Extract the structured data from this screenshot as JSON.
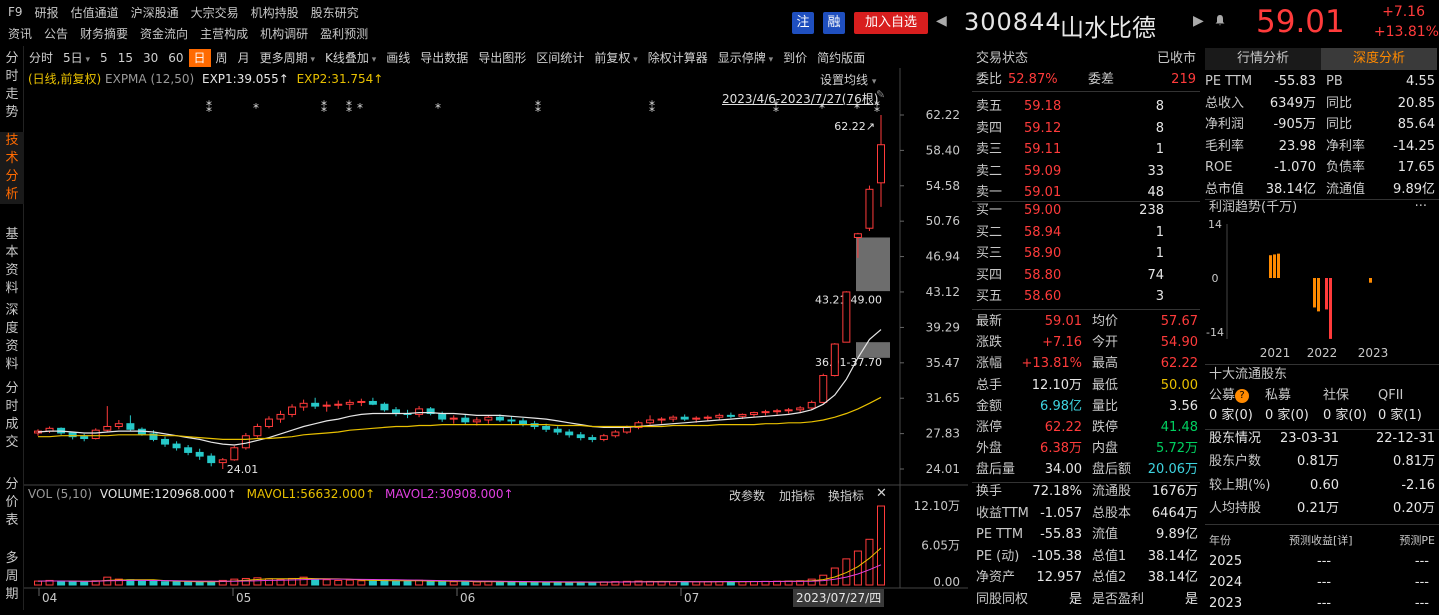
{
  "nav": {
    "row1": [
      "F9",
      "研报",
      "估值通道",
      "沪深股通",
      "大宗交易",
      "机构持股",
      "股东研究"
    ],
    "row2": [
      "资讯",
      "公告",
      "财务摘要",
      "资金流向",
      "主营构成",
      "机构调研",
      "盈利预测"
    ]
  },
  "title": {
    "zhu": "注",
    "rong": "融",
    "add_watch": "加入自选",
    "code": "300844",
    "name": "山水比德",
    "price": "59.01",
    "change": "+7.16",
    "change_pct": "+13.81%"
  },
  "toolbar": [
    "分时",
    "5日",
    "5",
    "15",
    "30",
    "60",
    "日",
    "周",
    "月",
    "更多周期",
    "K线叠加",
    "画线",
    "导出数据",
    "导出图形",
    "区间统计",
    "前复权",
    "除权计算器",
    "显示停牌",
    "到价",
    "简约版面"
  ],
  "toolbar_dropdowns": [
    "5日",
    "更多周期",
    "K线叠加",
    "前复权",
    "显示停牌"
  ],
  "toolbar_active": "日",
  "sidebar": [
    "分时走势",
    "技术分析",
    "基本资料",
    "深度资料",
    "分时成交",
    "分价表",
    "多周期"
  ],
  "sidebar_active": "技术分析",
  "chart": {
    "legend_main": {
      "prefix": "(日线,前复权)",
      "name": "EXPMA",
      "params": "(12,50)",
      "exp1": "EXP1:39.055↑",
      "exp2": "EXP2:31.754↑"
    },
    "set_ma": "设置均线",
    "range_label": "2023/4/6-2023/7/27(76根)",
    "y_ticks": [
      "62.22",
      "58.40",
      "54.58",
      "50.76",
      "46.94",
      "43.12",
      "39.29",
      "35.47",
      "31.65",
      "27.83",
      "24.01"
    ],
    "annot_high": "62.22↗",
    "annot_low": "24.01",
    "gap1": "43.21-49.00",
    "gap2": "36.01-37.70",
    "legend_vol": {
      "name": "VOL",
      "params": "(5,10)",
      "vol": "VOLUME:120968.000↑",
      "mavol1": "MAVOL1:56632.000↑",
      "mavol2": "MAVOL2:30908.000↑"
    },
    "vol_ctrls": [
      "改参数",
      "加指标",
      "换指标"
    ],
    "vol_ticks": [
      "12.10万",
      "6.05万",
      "0.00"
    ],
    "x_labels": [
      "04",
      "05",
      "06",
      "07"
    ],
    "date_label": "2023/07/27/四"
  },
  "chart_data": {
    "type": "candlestick",
    "ylim": [
      24.01,
      62.22
    ],
    "candles": [
      [
        27.9,
        28.3,
        27.6,
        28.1
      ],
      [
        28.1,
        28.6,
        27.9,
        28.4
      ],
      [
        28.4,
        28.5,
        27.7,
        27.9
      ],
      [
        27.9,
        28.0,
        27.2,
        27.5
      ],
      [
        27.5,
        27.8,
        27.0,
        27.3
      ],
      [
        27.3,
        28.4,
        27.2,
        28.2
      ],
      [
        28.2,
        30.8,
        28.0,
        28.6
      ],
      [
        28.6,
        29.3,
        28.3,
        28.9
      ],
      [
        28.9,
        29.8,
        28.1,
        28.3
      ],
      [
        28.3,
        28.5,
        27.6,
        27.8
      ],
      [
        27.8,
        28.2,
        27.0,
        27.2
      ],
      [
        27.2,
        27.5,
        26.4,
        26.7
      ],
      [
        26.7,
        27.0,
        26.0,
        26.3
      ],
      [
        26.3,
        26.6,
        25.5,
        25.8
      ],
      [
        25.8,
        26.2,
        25.0,
        25.4
      ],
      [
        25.4,
        25.7,
        24.3,
        24.7
      ],
      [
        24.7,
        25.2,
        24.01,
        25.0
      ],
      [
        25.0,
        26.5,
        24.9,
        26.3
      ],
      [
        26.3,
        27.9,
        26.1,
        27.6
      ],
      [
        27.6,
        28.9,
        27.4,
        28.6
      ],
      [
        28.6,
        29.7,
        28.4,
        29.4
      ],
      [
        29.4,
        30.3,
        29.0,
        29.9
      ],
      [
        29.9,
        31.0,
        29.6,
        30.7
      ],
      [
        30.7,
        31.5,
        30.3,
        31.1
      ],
      [
        31.1,
        31.7,
        30.5,
        30.8
      ],
      [
        30.8,
        31.3,
        30.2,
        30.9
      ],
      [
        30.9,
        31.4,
        30.5,
        31.0
      ],
      [
        31.0,
        31.5,
        30.4,
        31.2
      ],
      [
        31.2,
        31.6,
        30.8,
        31.3
      ],
      [
        31.3,
        31.7,
        30.9,
        31.0
      ],
      [
        31.0,
        31.2,
        30.2,
        30.4
      ],
      [
        30.4,
        30.7,
        29.7,
        30.0
      ],
      [
        30.0,
        30.4,
        29.5,
        29.9
      ],
      [
        29.9,
        30.8,
        29.6,
        30.5
      ],
      [
        30.5,
        30.7,
        29.8,
        30.0
      ],
      [
        30.0,
        30.2,
        29.1,
        29.4
      ],
      [
        29.4,
        29.8,
        28.9,
        29.5
      ],
      [
        29.5,
        29.9,
        28.8,
        29.1
      ],
      [
        29.1,
        29.6,
        28.7,
        29.3
      ],
      [
        29.3,
        29.8,
        28.9,
        29.6
      ],
      [
        29.6,
        29.9,
        29.1,
        29.3
      ],
      [
        29.3,
        29.7,
        28.8,
        29.2
      ],
      [
        29.2,
        29.5,
        28.6,
        28.9
      ],
      [
        28.9,
        29.2,
        28.3,
        28.6
      ],
      [
        28.6,
        28.9,
        28.0,
        28.3
      ],
      [
        28.3,
        28.6,
        27.7,
        28.0
      ],
      [
        28.0,
        28.3,
        27.4,
        27.7
      ],
      [
        27.7,
        28.0,
        27.1,
        27.4
      ],
      [
        27.4,
        27.7,
        26.9,
        27.2
      ],
      [
        27.2,
        27.8,
        27.0,
        27.6
      ],
      [
        27.6,
        28.2,
        27.4,
        28.0
      ],
      [
        28.0,
        28.7,
        27.8,
        28.5
      ],
      [
        28.5,
        29.2,
        28.3,
        29.0
      ],
      [
        29.0,
        29.8,
        28.8,
        29.3
      ],
      [
        29.3,
        29.6,
        28.9,
        29.4
      ],
      [
        29.4,
        29.8,
        29.1,
        29.6
      ],
      [
        29.6,
        29.9,
        29.2,
        29.4
      ],
      [
        29.4,
        29.7,
        29.0,
        29.5
      ],
      [
        29.5,
        29.8,
        29.2,
        29.6
      ],
      [
        29.6,
        30.0,
        29.3,
        29.8
      ],
      [
        29.8,
        30.1,
        29.5,
        29.7
      ],
      [
        29.7,
        30.0,
        29.4,
        29.9
      ],
      [
        29.9,
        30.2,
        29.6,
        30.1
      ],
      [
        30.1,
        30.4,
        29.8,
        30.2
      ],
      [
        30.2,
        30.5,
        29.9,
        30.3
      ],
      [
        30.3,
        30.6,
        30.0,
        30.4
      ],
      [
        30.4,
        30.8,
        30.1,
        30.6
      ],
      [
        30.6,
        31.4,
        30.4,
        31.2
      ],
      [
        31.2,
        34.3,
        31.1,
        34.1
      ],
      [
        34.1,
        37.6,
        34.0,
        37.5
      ],
      [
        37.7,
        43.2,
        37.7,
        43.12
      ],
      [
        49.0,
        49.5,
        46.8,
        49.4
      ],
      [
        50.0,
        54.6,
        49.7,
        54.2
      ],
      [
        54.9,
        62.22,
        52.3,
        59.01
      ]
    ],
    "exp1": [
      28.0,
      28.1,
      28.1,
      28.0,
      27.9,
      27.9,
      28.0,
      28.1,
      28.1,
      28.1,
      28.0,
      27.8,
      27.6,
      27.4,
      27.2,
      26.9,
      26.7,
      26.6,
      26.8,
      27.1,
      27.4,
      27.8,
      28.2,
      28.6,
      28.9,
      29.2,
      29.4,
      29.7,
      29.9,
      30.0,
      30.0,
      30.0,
      30.0,
      30.1,
      30.1,
      30.0,
      30.0,
      29.9,
      29.8,
      29.8,
      29.8,
      29.7,
      29.6,
      29.5,
      29.4,
      29.2,
      29.0,
      28.8,
      28.6,
      28.5,
      28.5,
      28.5,
      28.6,
      28.7,
      28.8,
      28.9,
      29.0,
      29.1,
      29.2,
      29.3,
      29.4,
      29.5,
      29.6,
      29.7,
      29.8,
      29.9,
      30.1,
      30.4,
      31.0,
      32.0,
      33.7,
      36.0,
      38.0,
      39.06
    ],
    "exp2": [
      27.5,
      27.5,
      27.6,
      27.6,
      27.6,
      27.6,
      27.6,
      27.7,
      27.7,
      27.7,
      27.7,
      27.6,
      27.6,
      27.5,
      27.4,
      27.3,
      27.2,
      27.2,
      27.2,
      27.3,
      27.3,
      27.4,
      27.5,
      27.7,
      27.8,
      27.9,
      28.0,
      28.2,
      28.3,
      28.4,
      28.5,
      28.6,
      28.6,
      28.7,
      28.7,
      28.8,
      28.8,
      28.8,
      28.8,
      28.8,
      28.8,
      28.8,
      28.8,
      28.8,
      28.8,
      28.7,
      28.7,
      28.7,
      28.6,
      28.6,
      28.6,
      28.6,
      28.6,
      28.6,
      28.6,
      28.7,
      28.7,
      28.7,
      28.7,
      28.8,
      28.8,
      28.8,
      28.8,
      28.9,
      28.9,
      29.0,
      29.0,
      29.1,
      29.3,
      29.6,
      30.0,
      30.5,
      31.1,
      31.75
    ],
    "volume": [
      6000,
      7000,
      5500,
      5000,
      4500,
      6500,
      12000,
      9000,
      8000,
      6000,
      5500,
      5000,
      4800,
      5200,
      4700,
      5300,
      7000,
      9000,
      10000,
      11000,
      9500,
      8500,
      10000,
      12000,
      9000,
      8000,
      7000,
      7500,
      6500,
      6000,
      6800,
      6200,
      5800,
      7200,
      6000,
      5500,
      5000,
      5300,
      4800,
      5200,
      5000,
      4600,
      4400,
      4200,
      4000,
      4500,
      4300,
      4100,
      4000,
      4800,
      5200,
      5600,
      6000,
      5500,
      5000,
      5200,
      4800,
      4900,
      5100,
      5300,
      5000,
      5200,
      5400,
      5600,
      5800,
      6000,
      6500,
      9000,
      15000,
      26000,
      40000,
      52000,
      70000,
      120968
    ],
    "mavol1": [
      6000,
      6200,
      6100,
      5900,
      5600,
      5700,
      7000,
      7600,
      8000,
      8000,
      8100,
      6700,
      5900,
      5400,
      5000,
      5000,
      5400,
      6200,
      7400,
      8500,
      9500,
      9600,
      9600,
      10200,
      9800,
      9700,
      9300,
      8900,
      7600,
      7000,
      6800,
      6400,
      6500,
      6400,
      6200,
      6000,
      5800,
      5600,
      5100,
      5200,
      5000,
      4900,
      4800,
      4700,
      4500,
      4400,
      4300,
      4200,
      4200,
      4300,
      4500,
      4800,
      5100,
      5200,
      5500,
      5400,
      5300,
      5100,
      5000,
      5100,
      5100,
      5100,
      5200,
      5300,
      5400,
      5600,
      5700,
      6500,
      8300,
      12300,
      19000,
      28000,
      41000,
      56632
    ],
    "mavol2": [
      6000,
      6100,
      6100,
      6000,
      5800,
      5800,
      6400,
      6800,
      7100,
      7000,
      6900,
      6700,
      6400,
      6200,
      6000,
      5900,
      5800,
      5800,
      6100,
      6500,
      7000,
      7300,
      7700,
      8300,
      8700,
      9000,
      9000,
      8900,
      8600,
      8400,
      8200,
      8000,
      7700,
      7500,
      7100,
      6800,
      6500,
      6300,
      6000,
      5900,
      5700,
      5500,
      5300,
      5200,
      5000,
      4900,
      4800,
      4700,
      4600,
      4600,
      4600,
      4600,
      4700,
      4700,
      4800,
      4900,
      5000,
      5000,
      5100,
      5200,
      5300,
      5300,
      5300,
      5400,
      5400,
      5500,
      5500,
      5800,
      6700,
      8700,
      12100,
      16900,
      23500,
      30908
    ],
    "vol_max": 121000,
    "open_gaps": [
      {
        "range": "43.21-49.00",
        "y_low": 43.21,
        "y_high": 49.0
      },
      {
        "range": "36.01-37.70",
        "y_low": 36.01,
        "y_high": 37.7
      }
    ]
  },
  "book": {
    "status_label": "交易状态",
    "status_value": "已收市",
    "weibi_label": "委比",
    "weibi_value": "52.87%",
    "weicha_label": "委差",
    "weicha_value": "219",
    "sells": [
      {
        "label": "卖五",
        "price": "59.18",
        "vol": "8"
      },
      {
        "label": "卖四",
        "price": "59.12",
        "vol": "8"
      },
      {
        "label": "卖三",
        "price": "59.11",
        "vol": "1"
      },
      {
        "label": "卖二",
        "price": "59.09",
        "vol": "33"
      },
      {
        "label": "卖一",
        "price": "59.01",
        "vol": "48"
      }
    ],
    "buys": [
      {
        "label": "买一",
        "price": "59.00",
        "vol": "238"
      },
      {
        "label": "买二",
        "price": "58.94",
        "vol": "1"
      },
      {
        "label": "买三",
        "price": "58.90",
        "vol": "1"
      },
      {
        "label": "买四",
        "price": "58.80",
        "vol": "74"
      },
      {
        "label": "买五",
        "price": "58.60",
        "vol": "3"
      }
    ],
    "stats": [
      [
        {
          "l": "最新",
          "v": "59.01",
          "c": "red"
        },
        {
          "l": "均价",
          "v": "57.67",
          "c": "red"
        }
      ],
      [
        {
          "l": "涨跌",
          "v": "+7.16",
          "c": "red"
        },
        {
          "l": "今开",
          "v": "54.90",
          "c": "red"
        }
      ],
      [
        {
          "l": "涨幅",
          "v": "+13.81%",
          "c": "red"
        },
        {
          "l": "最高",
          "v": "62.22",
          "c": "red"
        }
      ],
      [
        {
          "l": "总手",
          "v": "12.10万",
          "c": "white"
        },
        {
          "l": "最低",
          "v": "50.00",
          "c": "yellow"
        }
      ],
      [
        {
          "l": "金额",
          "v": "6.98亿",
          "c": "cyan"
        },
        {
          "l": "量比",
          "v": "3.56",
          "c": "white"
        }
      ],
      [
        {
          "l": "涨停",
          "v": "62.22",
          "c": "red"
        },
        {
          "l": "跌停",
          "v": "41.48",
          "c": "green"
        }
      ],
      [
        {
          "l": "外盘",
          "v": "6.38万",
          "c": "red"
        },
        {
          "l": "内盘",
          "v": "5.72万",
          "c": "green"
        }
      ],
      [
        {
          "l": "盘后量",
          "v": "34.00",
          "c": "white"
        },
        {
          "l": "盘后额",
          "v": "20.06万",
          "c": "cyan"
        }
      ]
    ],
    "stats2": [
      [
        {
          "l": "换手",
          "v": "72.18%"
        },
        {
          "l": "流通股",
          "v": "1676万"
        }
      ],
      [
        {
          "l": "收益TTM",
          "v": "-1.057"
        },
        {
          "l": "总股本",
          "v": "6464万"
        }
      ],
      [
        {
          "l": "PE TTM",
          "v": "-55.83"
        },
        {
          "l": "流值",
          "v": "9.89亿"
        }
      ],
      [
        {
          "l": "PE (动)",
          "v": "-105.38"
        },
        {
          "l": "总值1",
          "v": "38.14亿"
        }
      ],
      [
        {
          "l": "净资产",
          "v": "12.957"
        },
        {
          "l": "总值2",
          "v": "38.14亿"
        }
      ],
      [
        {
          "l": "同股同权",
          "v": "是"
        },
        {
          "l": "是否盈利",
          "v": "是"
        }
      ]
    ]
  },
  "right": {
    "tabs": [
      "行情分析",
      "深度分析"
    ],
    "active_tab": "深度分析",
    "fin": [
      [
        {
          "l": "PE TTM",
          "v": "-55.83"
        },
        {
          "l": "PB",
          "v": "4.55"
        }
      ],
      [
        {
          "l": "总收入",
          "v": "6349万"
        },
        {
          "l": "同比",
          "v": "20.85"
        }
      ],
      [
        {
          "l": "净利润",
          "v": "-905万"
        },
        {
          "l": "同比",
          "v": "85.64"
        }
      ],
      [
        {
          "l": "毛利率",
          "v": "23.98"
        },
        {
          "l": "净利率",
          "v": "-14.25"
        }
      ],
      [
        {
          "l": "ROE",
          "v": "-1.070"
        },
        {
          "l": "负债率",
          "v": "17.65"
        }
      ],
      [
        {
          "l": "总市值",
          "v": "38.14亿"
        },
        {
          "l": "流通值",
          "v": "9.89亿"
        }
      ]
    ],
    "profit_title": "利润趋势(千万)",
    "profit_yticks": [
      "14",
      "0",
      "-14"
    ],
    "profit_years": [
      "2021",
      "2022",
      "2023"
    ],
    "profit_bars": [
      {
        "year": "2021",
        "color": "#ff8a00",
        "values": [
          5.8,
          6.0,
          6.2
        ]
      },
      {
        "year": "2022",
        "color": "#ff8a00",
        "values": [
          -7.5,
          -8.5
        ]
      },
      {
        "year": "2022b",
        "color": "#ff3b3b",
        "values": [
          -8.0,
          -15.5
        ]
      },
      {
        "year": "2023",
        "color": "#ff8a00",
        "values": [
          -1.2
        ]
      }
    ],
    "top10_title": "十大流通股东",
    "holders_head": [
      "公募",
      "私募",
      "社保",
      "QFII"
    ],
    "holders_vals": [
      "0 家(0)",
      "0 家(0)",
      "0 家(0)",
      "0 家(1)"
    ],
    "share_head": [
      "股东情况",
      "23-03-31",
      "22-12-31"
    ],
    "share_rows": [
      [
        "股东户数",
        "0.81万",
        "0.81万"
      ],
      [
        "较上期(%)",
        "0.60",
        "-2.16"
      ],
      [
        "人均持股",
        "0.21万",
        "0.20万"
      ]
    ],
    "forecast_head": [
      "年份",
      "预测收益[详]",
      "预测PE"
    ],
    "forecast_rows": [
      [
        "2025",
        "---",
        "---"
      ],
      [
        "2024",
        "---",
        "---"
      ],
      [
        "2023",
        "---",
        "---"
      ]
    ]
  }
}
